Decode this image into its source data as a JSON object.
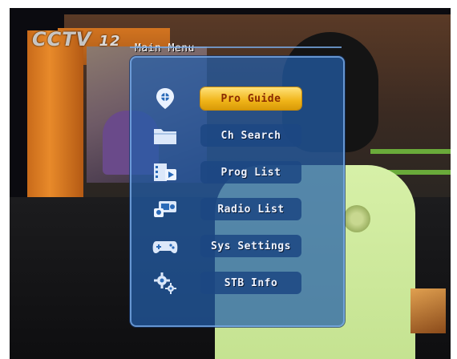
{
  "channel_logo": {
    "text": "CCTV",
    "number": "12"
  },
  "menu": {
    "title": "Main Menu",
    "selected_index": 0,
    "items": [
      {
        "label": "Pro Guide",
        "icon": "compass-icon"
      },
      {
        "label": "Ch Search",
        "icon": "folder-icon"
      },
      {
        "label": "Prog List",
        "icon": "film-list-icon"
      },
      {
        "label": "Radio List",
        "icon": "radio-icon"
      },
      {
        "label": "Sys Settings",
        "icon": "gamepad-icon"
      },
      {
        "label": "STB Info",
        "icon": "gears-icon"
      }
    ]
  },
  "colors": {
    "panel": "#225eaa",
    "selected": "#f0b418",
    "selected_text": "#8a2a00",
    "button": "#1c4682"
  }
}
